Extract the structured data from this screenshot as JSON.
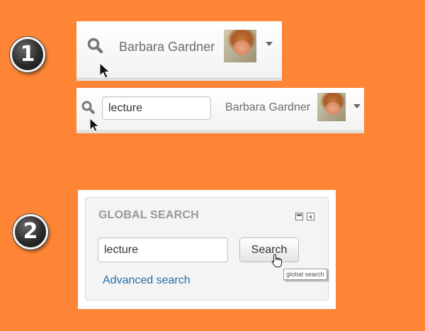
{
  "steps": [
    "1",
    "2"
  ],
  "header_collapsed": {
    "user_name": "Barbara Gardner"
  },
  "header_expanded": {
    "search_value": "lecture",
    "user_name": "Barbara Gardner"
  },
  "global_search_block": {
    "title": "GLOBAL SEARCH",
    "search_value": "lecture",
    "search_button_label": "Search",
    "advanced_search_link": "Advanced search",
    "tooltip": "global search"
  },
  "colors": {
    "background": "#fd8535",
    "link": "#1e70b3",
    "title_gray": "#999999"
  }
}
